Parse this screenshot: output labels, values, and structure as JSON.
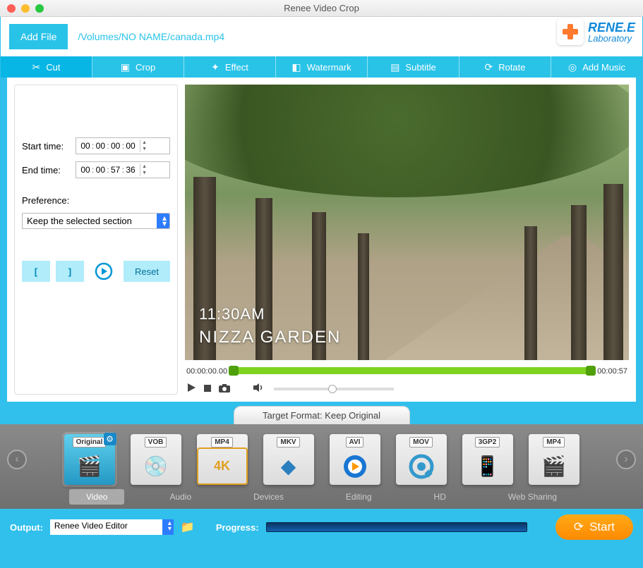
{
  "window": {
    "title": "Renee Video Crop"
  },
  "logo": {
    "line1": "RENE.E",
    "line2": "Laboratory"
  },
  "header": {
    "add_file": "Add File",
    "file_path": "/Volumes/NO NAME/canada.mp4"
  },
  "tabs": {
    "cut": "Cut",
    "crop": "Crop",
    "effect": "Effect",
    "watermark": "Watermark",
    "subtitle": "Subtitle",
    "rotate": "Rotate",
    "add_music": "Add Music"
  },
  "side": {
    "start_label": "Start time:",
    "start": {
      "h": "00",
      "m": "00",
      "s": "00",
      "f": "00"
    },
    "end_label": "End time:",
    "end": {
      "h": "00",
      "m": "00",
      "s": "57",
      "f": "36"
    },
    "pref_label": "Preference:",
    "pref_value": "Keep the selected section",
    "mark_in": "[",
    "mark_out": "]",
    "reset": "Reset"
  },
  "preview": {
    "overlay_time": "11:30AM",
    "overlay_location": "NIZZA GARDEN",
    "tl_start": "00:00:00.00",
    "tl_end": "00:00:57"
  },
  "target": {
    "header": "Target Format: Keep Original",
    "cards": [
      {
        "label": "Original"
      },
      {
        "label": "VOB"
      },
      {
        "label": "MP4",
        "sub": "4K"
      },
      {
        "label": "MKV"
      },
      {
        "label": "AVI"
      },
      {
        "label": "MOV"
      },
      {
        "label": "3GP2"
      },
      {
        "label": "MP4"
      }
    ],
    "categories": {
      "video": "Video",
      "audio": "Audio",
      "devices": "Devices",
      "editing": "Editing",
      "hd": "HD",
      "web": "Web Sharing"
    }
  },
  "footer": {
    "output_label": "Output:",
    "output_value": "Renee Video Editor",
    "progress_label": "Progress:",
    "start": "Start"
  }
}
